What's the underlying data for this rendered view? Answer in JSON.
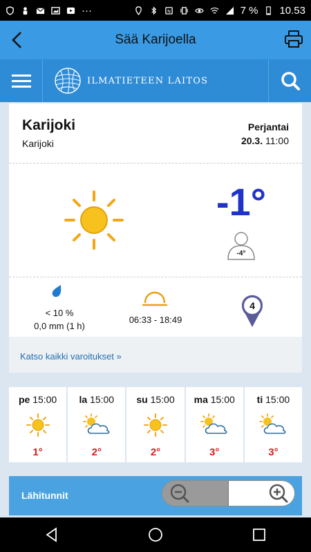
{
  "status_bar": {
    "time": "10.53",
    "battery": "7 %"
  },
  "app_bar": {
    "title": "Sää Karijoella"
  },
  "header": {
    "brand": "ILMATIETEEN LAITOS"
  },
  "current": {
    "location": "Karijoki",
    "sublocation": "Karijoki",
    "weekday": "Perjantai",
    "date": "20.3.",
    "time": "11:00",
    "temperature": "-1°",
    "feels_like": "-4°",
    "precip_prob": "< 10 %",
    "precip_amount": "0,0 mm (1 h)",
    "sun_times": "06:33 - 18:49",
    "warning_level": "4",
    "warnings_link": "Katso kaikki varoitukset »"
  },
  "forecast": [
    {
      "day": "pe",
      "time": "15:00",
      "icon": "sun-icon",
      "temp": "1°"
    },
    {
      "day": "la",
      "time": "15:00",
      "icon": "partly-cloudy-icon",
      "temp": "2°"
    },
    {
      "day": "su",
      "time": "15:00",
      "icon": "sun-icon",
      "temp": "2°"
    },
    {
      "day": "ma",
      "time": "15:00",
      "icon": "partly-cloudy-icon",
      "temp": "3°"
    },
    {
      "day": "ti",
      "time": "15:00",
      "icon": "partly-cloudy-icon",
      "temp": "3°"
    }
  ],
  "nearby": {
    "label": "Lähitunnit"
  },
  "colors": {
    "app_bar": "#3a9ae3",
    "header": "#2e8bd6",
    "temperature": "#1f33c9",
    "forecast_temp": "#d21e1e"
  }
}
